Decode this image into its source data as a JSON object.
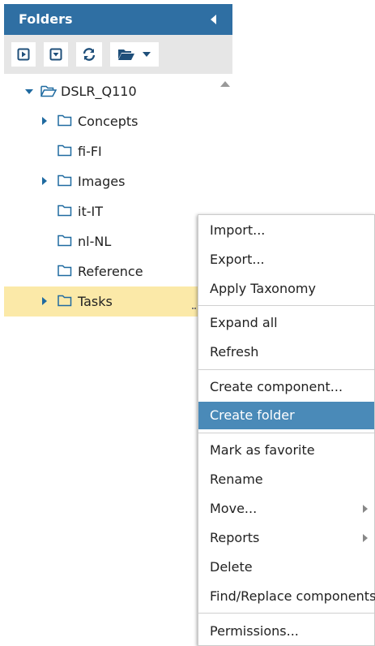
{
  "panel": {
    "title": "Folders"
  },
  "toolbar": {
    "buttons": [
      "expand-button",
      "collapse-button",
      "refresh-button",
      "folder-menu-button"
    ]
  },
  "tree": {
    "root": {
      "label": "DSLR_Q110"
    },
    "items": [
      {
        "label": "Concepts",
        "expandable": true
      },
      {
        "label": "fi-FI",
        "expandable": false
      },
      {
        "label": "Images",
        "expandable": true
      },
      {
        "label": "it-IT",
        "expandable": false
      },
      {
        "label": "nl-NL",
        "expandable": false
      },
      {
        "label": "Reference",
        "expandable": false
      },
      {
        "label": "Tasks",
        "expandable": true,
        "selected": true
      }
    ]
  },
  "menu": {
    "items": [
      {
        "label": "Import..."
      },
      {
        "label": "Export..."
      },
      {
        "label": "Apply Taxonomy"
      },
      {
        "label": "Expand all"
      },
      {
        "label": "Refresh"
      },
      {
        "label": "Create component..."
      },
      {
        "label": "Create folder",
        "active": true
      },
      {
        "label": "Mark as favorite"
      },
      {
        "label": "Rename"
      },
      {
        "label": "Move...",
        "submenu": true
      },
      {
        "label": "Reports",
        "submenu": true
      },
      {
        "label": "Delete"
      },
      {
        "label": "Find/Replace components"
      },
      {
        "label": "Permissions..."
      }
    ]
  },
  "colors": {
    "header": "#2f6fa3",
    "accent": "#1f6aa0",
    "selected_row": "#fbe9a8",
    "menu_active": "#4a8ab8"
  }
}
